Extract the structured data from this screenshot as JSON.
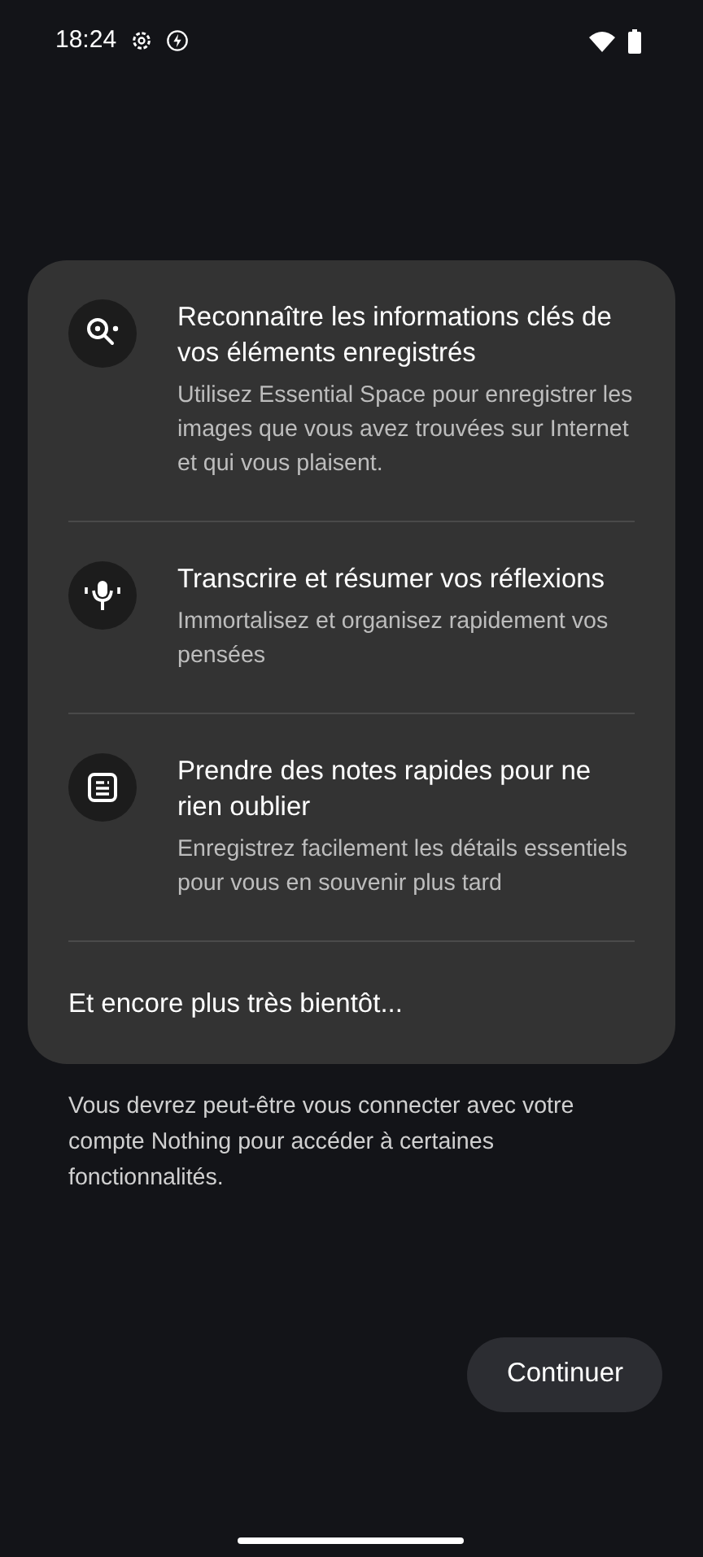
{
  "status_bar": {
    "time": "18:24"
  },
  "features": [
    {
      "kind": "search",
      "title": "Reconnaître les informations clés de vos éléments enregistrés",
      "description": "Utilisez Essential Space pour enregistrer les images que vous avez trouvées sur Internet et qui vous plaisent."
    },
    {
      "kind": "mic",
      "title": "Transcrire et résumer vos réflexions",
      "description": "Immortalisez et organisez rapidement vos pensées"
    },
    {
      "kind": "note",
      "title": "Prendre des notes rapides pour ne rien oublier",
      "description": "Enregistrez facilement les détails essentiels pour vous en souvenir plus tard"
    }
  ],
  "more": "Et encore plus très bientôt...",
  "notice": "Vous devrez peut-être vous connecter avec votre compte Nothing pour accéder à certaines fonctionnalités.",
  "button": "Continuer"
}
